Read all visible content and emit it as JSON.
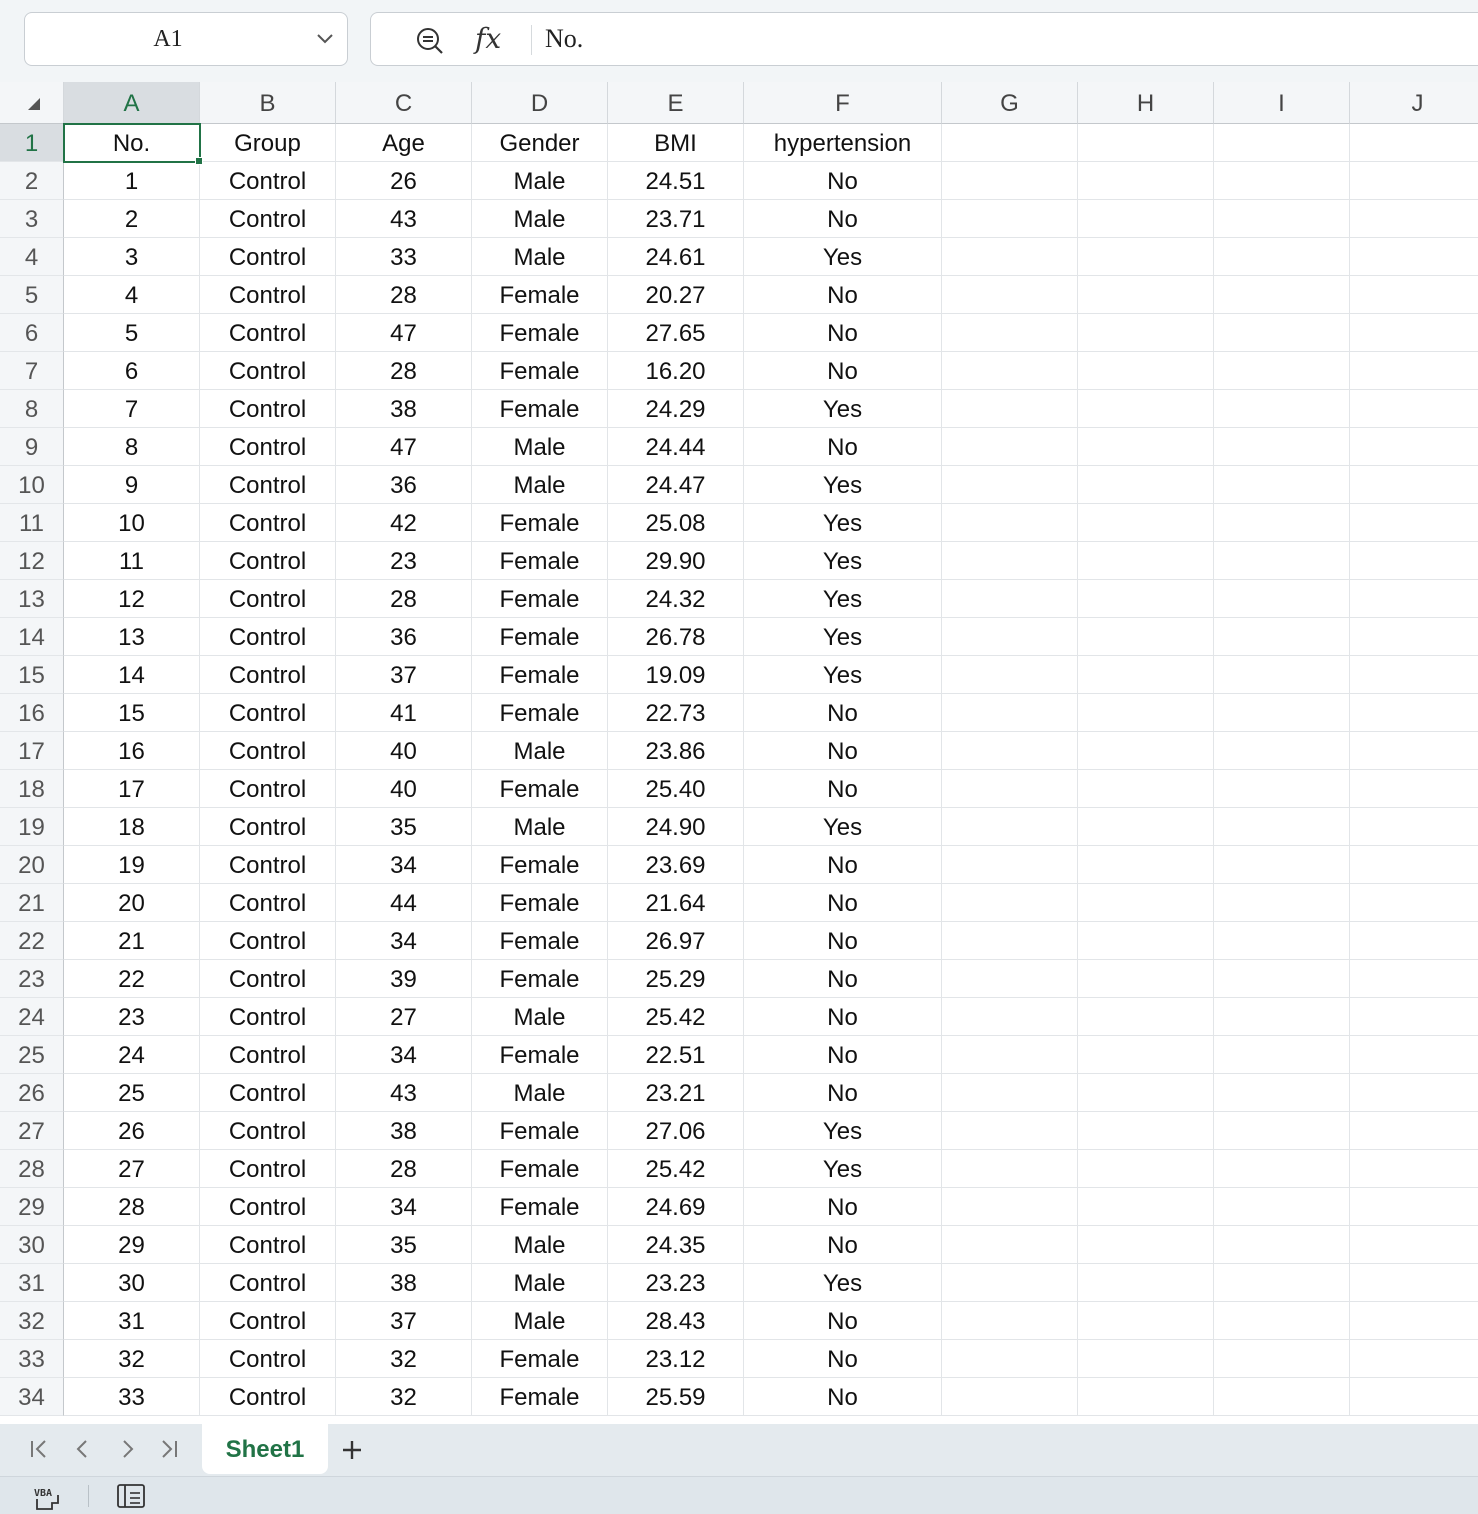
{
  "name_box": {
    "value": "A1",
    "dropdown_icon": "chevron-down-icon"
  },
  "formula_bar": {
    "zoom_icon": "zoom-out-icon",
    "fx_label": "fx",
    "content": "No."
  },
  "columns": [
    "A",
    "B",
    "C",
    "D",
    "E",
    "F",
    "G",
    "H",
    "I",
    "J"
  ],
  "selected_column": "A",
  "rows": [
    [
      "No.",
      "Group",
      "Age",
      "Gender",
      "BMI",
      "hypertension"
    ],
    [
      "1",
      "Control",
      "26",
      "Male",
      "24.51",
      "No"
    ],
    [
      "2",
      "Control",
      "43",
      "Male",
      "23.71",
      "No"
    ],
    [
      "3",
      "Control",
      "33",
      "Male",
      "24.61",
      "Yes"
    ],
    [
      "4",
      "Control",
      "28",
      "Female",
      "20.27",
      "No"
    ],
    [
      "5",
      "Control",
      "47",
      "Female",
      "27.65",
      "No"
    ],
    [
      "6",
      "Control",
      "28",
      "Female",
      "16.20",
      "No"
    ],
    [
      "7",
      "Control",
      "38",
      "Female",
      "24.29",
      "Yes"
    ],
    [
      "8",
      "Control",
      "47",
      "Male",
      "24.44",
      "No"
    ],
    [
      "9",
      "Control",
      "36",
      "Male",
      "24.47",
      "Yes"
    ],
    [
      "10",
      "Control",
      "42",
      "Female",
      "25.08",
      "Yes"
    ],
    [
      "11",
      "Control",
      "23",
      "Female",
      "29.90",
      "Yes"
    ],
    [
      "12",
      "Control",
      "28",
      "Female",
      "24.32",
      "Yes"
    ],
    [
      "13",
      "Control",
      "36",
      "Female",
      "26.78",
      "Yes"
    ],
    [
      "14",
      "Control",
      "37",
      "Female",
      "19.09",
      "Yes"
    ],
    [
      "15",
      "Control",
      "41",
      "Female",
      "22.73",
      "No"
    ],
    [
      "16",
      "Control",
      "40",
      "Male",
      "23.86",
      "No"
    ],
    [
      "17",
      "Control",
      "40",
      "Female",
      "25.40",
      "No"
    ],
    [
      "18",
      "Control",
      "35",
      "Male",
      "24.90",
      "Yes"
    ],
    [
      "19",
      "Control",
      "34",
      "Female",
      "23.69",
      "No"
    ],
    [
      "20",
      "Control",
      "44",
      "Female",
      "21.64",
      "No"
    ],
    [
      "21",
      "Control",
      "34",
      "Female",
      "26.97",
      "No"
    ],
    [
      "22",
      "Control",
      "39",
      "Female",
      "25.29",
      "No"
    ],
    [
      "23",
      "Control",
      "27",
      "Male",
      "25.42",
      "No"
    ],
    [
      "24",
      "Control",
      "34",
      "Female",
      "22.51",
      "No"
    ],
    [
      "25",
      "Control",
      "43",
      "Male",
      "23.21",
      "No"
    ],
    [
      "26",
      "Control",
      "38",
      "Female",
      "27.06",
      "Yes"
    ],
    [
      "27",
      "Control",
      "28",
      "Female",
      "25.42",
      "Yes"
    ],
    [
      "28",
      "Control",
      "34",
      "Female",
      "24.69",
      "No"
    ],
    [
      "29",
      "Control",
      "35",
      "Male",
      "24.35",
      "No"
    ],
    [
      "30",
      "Control",
      "38",
      "Male",
      "23.23",
      "Yes"
    ],
    [
      "31",
      "Control",
      "37",
      "Male",
      "28.43",
      "No"
    ],
    [
      "32",
      "Control",
      "32",
      "Female",
      "23.12",
      "No"
    ],
    [
      "33",
      "Control",
      "32",
      "Female",
      "25.59",
      "No"
    ]
  ],
  "sheet_tabs": [
    {
      "label": "Sheet1",
      "active": true
    }
  ],
  "colors": {
    "accent": "#217346",
    "header_bg": "#f4f6f8",
    "selected_header_bg": "#d9dde1"
  }
}
